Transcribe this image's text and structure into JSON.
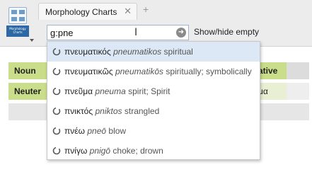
{
  "app": {
    "icon_label": "Morphology Charts",
    "icon_name": "morphology-charts-icon"
  },
  "tab": {
    "title": "Morphology Charts",
    "close_glyph": "✕",
    "new_tab_glyph": "+"
  },
  "search": {
    "value": "g:pne",
    "go_icon": "arrow-right-circle-icon"
  },
  "toolbar": {
    "show_hide_label": "Show/hide empty"
  },
  "chart": {
    "row1_label": "Noun",
    "row2_label": "Neuter",
    "right_col_header_fragment": "ative",
    "right_col_value_fragment": "μα"
  },
  "suggestions": [
    {
      "greek": "πνευματικός",
      "translit": "pneumatikos",
      "gloss": "spiritual",
      "selected": true
    },
    {
      "greek": "πνευματικῶς",
      "translit": "pneumatikōs",
      "gloss": "spiritually; symbolically",
      "selected": false
    },
    {
      "greek": "πνεῦμα",
      "translit": "pneuma",
      "gloss": "spirit; Spirit",
      "selected": false
    },
    {
      "greek": "πνικτός",
      "translit": "pniktos",
      "gloss": "strangled",
      "selected": false
    },
    {
      "greek": "πνέω",
      "translit": "pneō",
      "gloss": "blow",
      "selected": false
    },
    {
      "greek": "πνίγω",
      "translit": "pnigō",
      "gloss": "choke; drown",
      "selected": false
    }
  ],
  "colors": {
    "header_green": "#c9dd8a",
    "selected_row": "#dce8f6",
    "icon_blue": "#2d67a4"
  }
}
